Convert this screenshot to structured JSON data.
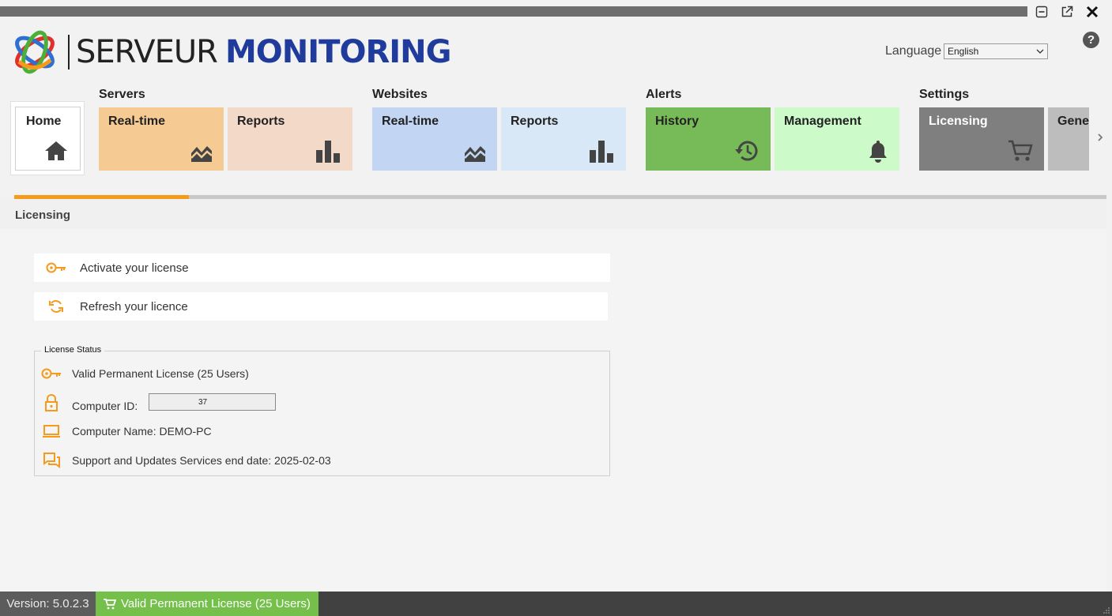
{
  "app": {
    "logo_word1": "SERVEUR",
    "logo_word2": "MONITORING"
  },
  "window_controls": [
    "minimize-icon",
    "popout-icon",
    "close-icon"
  ],
  "language": {
    "label": "Language",
    "selected": "English"
  },
  "help_label": "?",
  "nav": {
    "groups": [
      "Servers",
      "Websites",
      "Alerts",
      "Settings"
    ],
    "home": "Home",
    "servers_realtime": "Real-time",
    "servers_reports": "Reports",
    "websites_realtime": "Real-time",
    "websites_reports": "Reports",
    "alerts_history": "History",
    "alerts_management": "Management",
    "settings_licensing": "Licensing",
    "settings_general": "Gener"
  },
  "colors": {
    "servers_realtime": "#f5cb93",
    "servers_reports": "#f3d9c8",
    "websites_realtime": "#c2d6f3",
    "websites_reports": "#d9e8f6",
    "alerts_history": "#77bb58",
    "alerts_management": "#ccfbc9",
    "settings_licensing": "#7f7f7f",
    "settings_general": "#bdbdbd",
    "accent": "#f59a1b",
    "valid_green": "#74c04a"
  },
  "progress_fraction": 0.16,
  "section_title": "Licensing",
  "actions": {
    "activate": "Activate your license",
    "refresh": "Refresh your licence"
  },
  "license_status": {
    "legend": "License Status",
    "type": "Valid Permanent License (25 Users)",
    "computer_id_label": "Computer ID:",
    "computer_id_value": "37",
    "computer_name": "Computer Name: DEMO-PC",
    "support_end": "Support and Updates Services end date: 2025-02-03"
  },
  "statusbar": {
    "version": "Version: 5.0.2.3",
    "license": "Valid Permanent License (25 Users)"
  }
}
